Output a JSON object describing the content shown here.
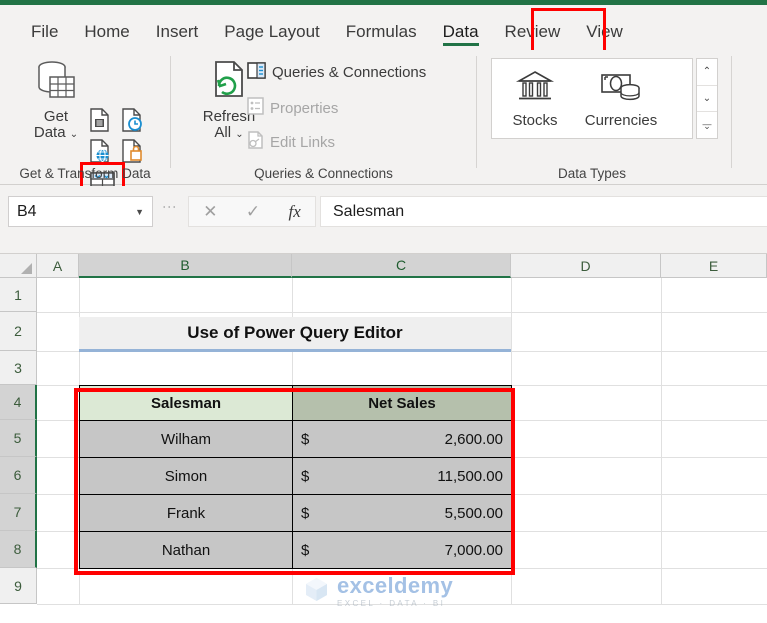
{
  "ribbon": {
    "tabs": [
      {
        "label": "File"
      },
      {
        "label": "Home"
      },
      {
        "label": "Insert"
      },
      {
        "label": "Page Layout"
      },
      {
        "label": "Formulas"
      },
      {
        "label": "Data"
      },
      {
        "label": "Review"
      },
      {
        "label": "View"
      }
    ],
    "active_tab": "Data",
    "groups": {
      "get_transform": {
        "label": "Get & Transform Data",
        "get_data": {
          "line1": "Get",
          "line2": "Data",
          "caret": "⌄"
        },
        "small_buttons": [
          {
            "name": "from-text-csv-icon"
          },
          {
            "name": "from-recent-sources-icon"
          },
          {
            "name": "from-web-icon"
          },
          {
            "name": "from-table-range-icon"
          },
          {
            "name": "existing-connections-icon"
          }
        ]
      },
      "queries": {
        "label": "Queries & Connections",
        "refresh_all": {
          "line1": "Refresh",
          "line2": "All",
          "caret": "⌄"
        },
        "items": [
          {
            "label": "Queries & Connections",
            "enabled": true
          },
          {
            "label": "Properties",
            "enabled": false
          },
          {
            "label": "Edit Links",
            "enabled": false
          }
        ]
      },
      "data_types": {
        "label": "Data Types",
        "items": [
          {
            "label": "Stocks"
          },
          {
            "label": "Currencies"
          }
        ],
        "scroll": {
          "up": "⌃",
          "down": "⌄",
          "more": "⌄"
        }
      }
    }
  },
  "formula_bar": {
    "name_box": "B4",
    "name_box_caret": "▼",
    "cancel": "✕",
    "enter": "✓",
    "insert_function": "fx",
    "formula_value": "Salesman"
  },
  "sheet": {
    "columns": [
      "A",
      "B",
      "C",
      "D",
      "E"
    ],
    "selected_columns": [
      "B",
      "C"
    ],
    "rows": [
      "1",
      "2",
      "3",
      "4",
      "5",
      "6",
      "7",
      "8",
      "9"
    ],
    "selected_rows": [
      "4",
      "5",
      "6",
      "7",
      "8"
    ],
    "title_cell": "Use of Power Query Editor",
    "table": {
      "headers": [
        "Salesman",
        "Net Sales"
      ],
      "currency_symbol": "$",
      "rows": [
        {
          "salesman": "Wilham",
          "net_sales": "2,600.00"
        },
        {
          "salesman": "Simon",
          "net_sales": "11,500.00"
        },
        {
          "salesman": "Frank",
          "net_sales": "5,500.00"
        },
        {
          "salesman": "Nathan",
          "net_sales": "7,000.00"
        }
      ]
    }
  },
  "watermark": {
    "name": "exceldemy",
    "tagline": "EXCEL · DATA · BI"
  },
  "colors": {
    "excel_green": "#217346",
    "highlight_red": "#ff0000",
    "header_light_green": "#dce9d5",
    "header_sage": "#b5c0ac",
    "cell_gray": "#c6c6c6"
  }
}
